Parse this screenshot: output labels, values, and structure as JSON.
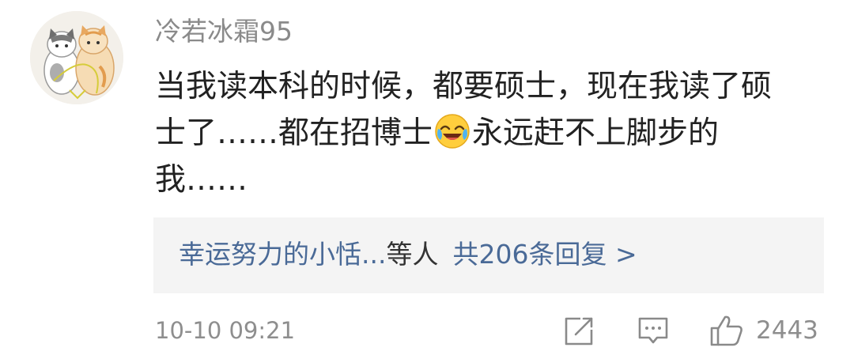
{
  "comment": {
    "username": "冷若冰霜95",
    "text_lines": [
      "当我读本科的时候，都要硕士，现在我读了硕",
      "士了……都在招博士",
      "永远赶不上脚步的",
      "我……"
    ],
    "emoji_icon": "laughing-crying-face-icon",
    "timestamp": "10-10 09:21",
    "like_count": "2443"
  },
  "replies": {
    "names": "幸运努力的小恬...",
    "connector": "等人",
    "count_label": "共206条回复 >"
  },
  "colors": {
    "link_blue": "#4a6a97",
    "meta_gray": "#8e8e8e",
    "reply_bg": "#f4f4f4"
  }
}
